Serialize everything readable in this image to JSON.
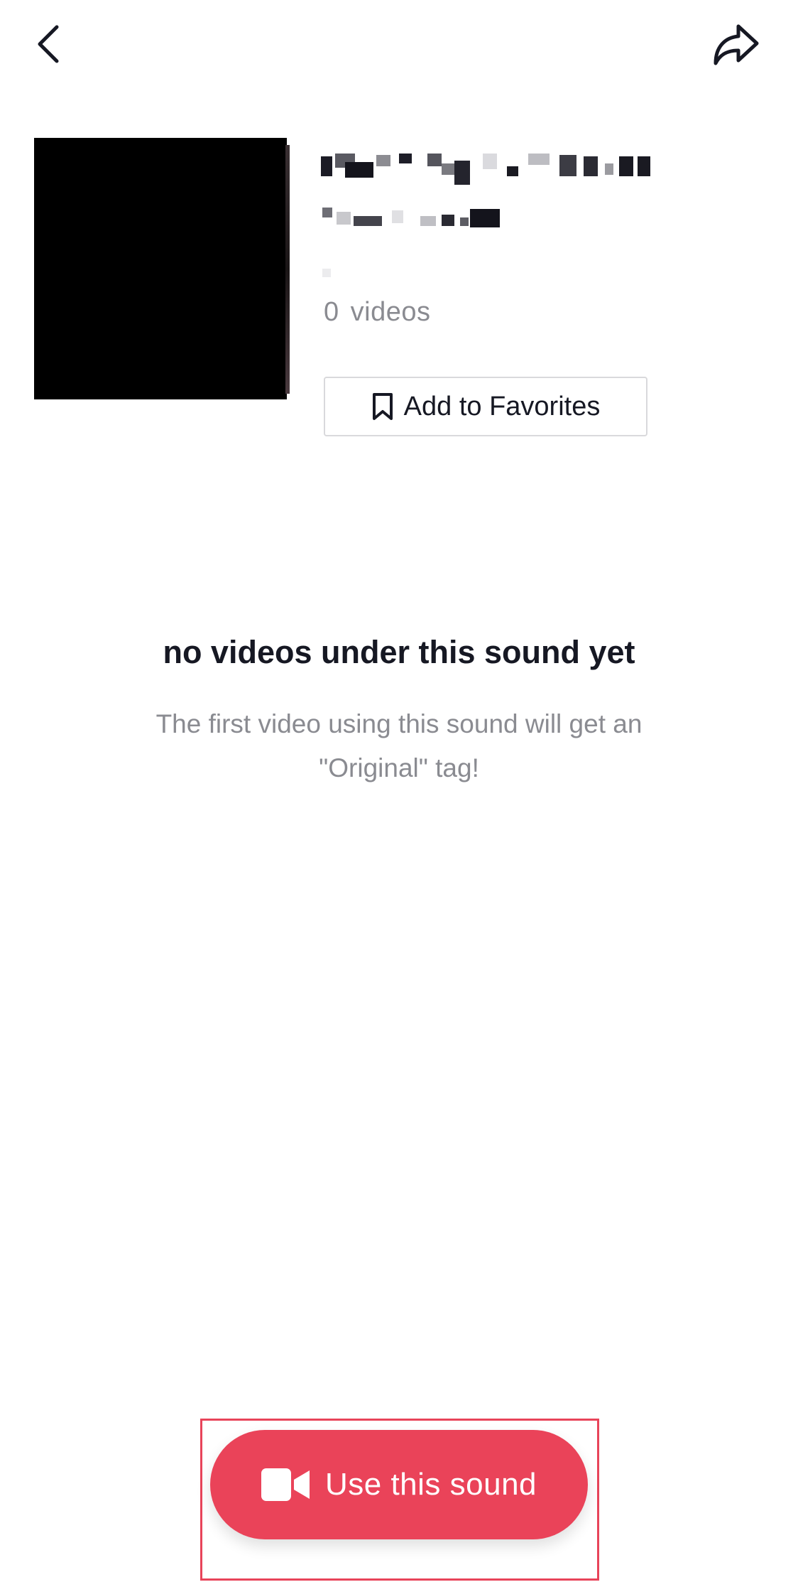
{
  "header": {
    "back_icon": "chevron-left-icon",
    "share_icon": "share-arrow-icon"
  },
  "sound": {
    "cover_color": "#000000",
    "video_count": "0",
    "video_count_label": "videos"
  },
  "favorites": {
    "icon": "bookmark-icon",
    "label": "Add to Favorites"
  },
  "empty_state": {
    "title": "no videos under this sound yet",
    "subtitle": "The first video using this sound will get an \"Original\" tag!"
  },
  "cta": {
    "icon": "video-camera-icon",
    "label": "Use this sound",
    "color": "#ea4359",
    "highlight_color": "#e8445a"
  }
}
